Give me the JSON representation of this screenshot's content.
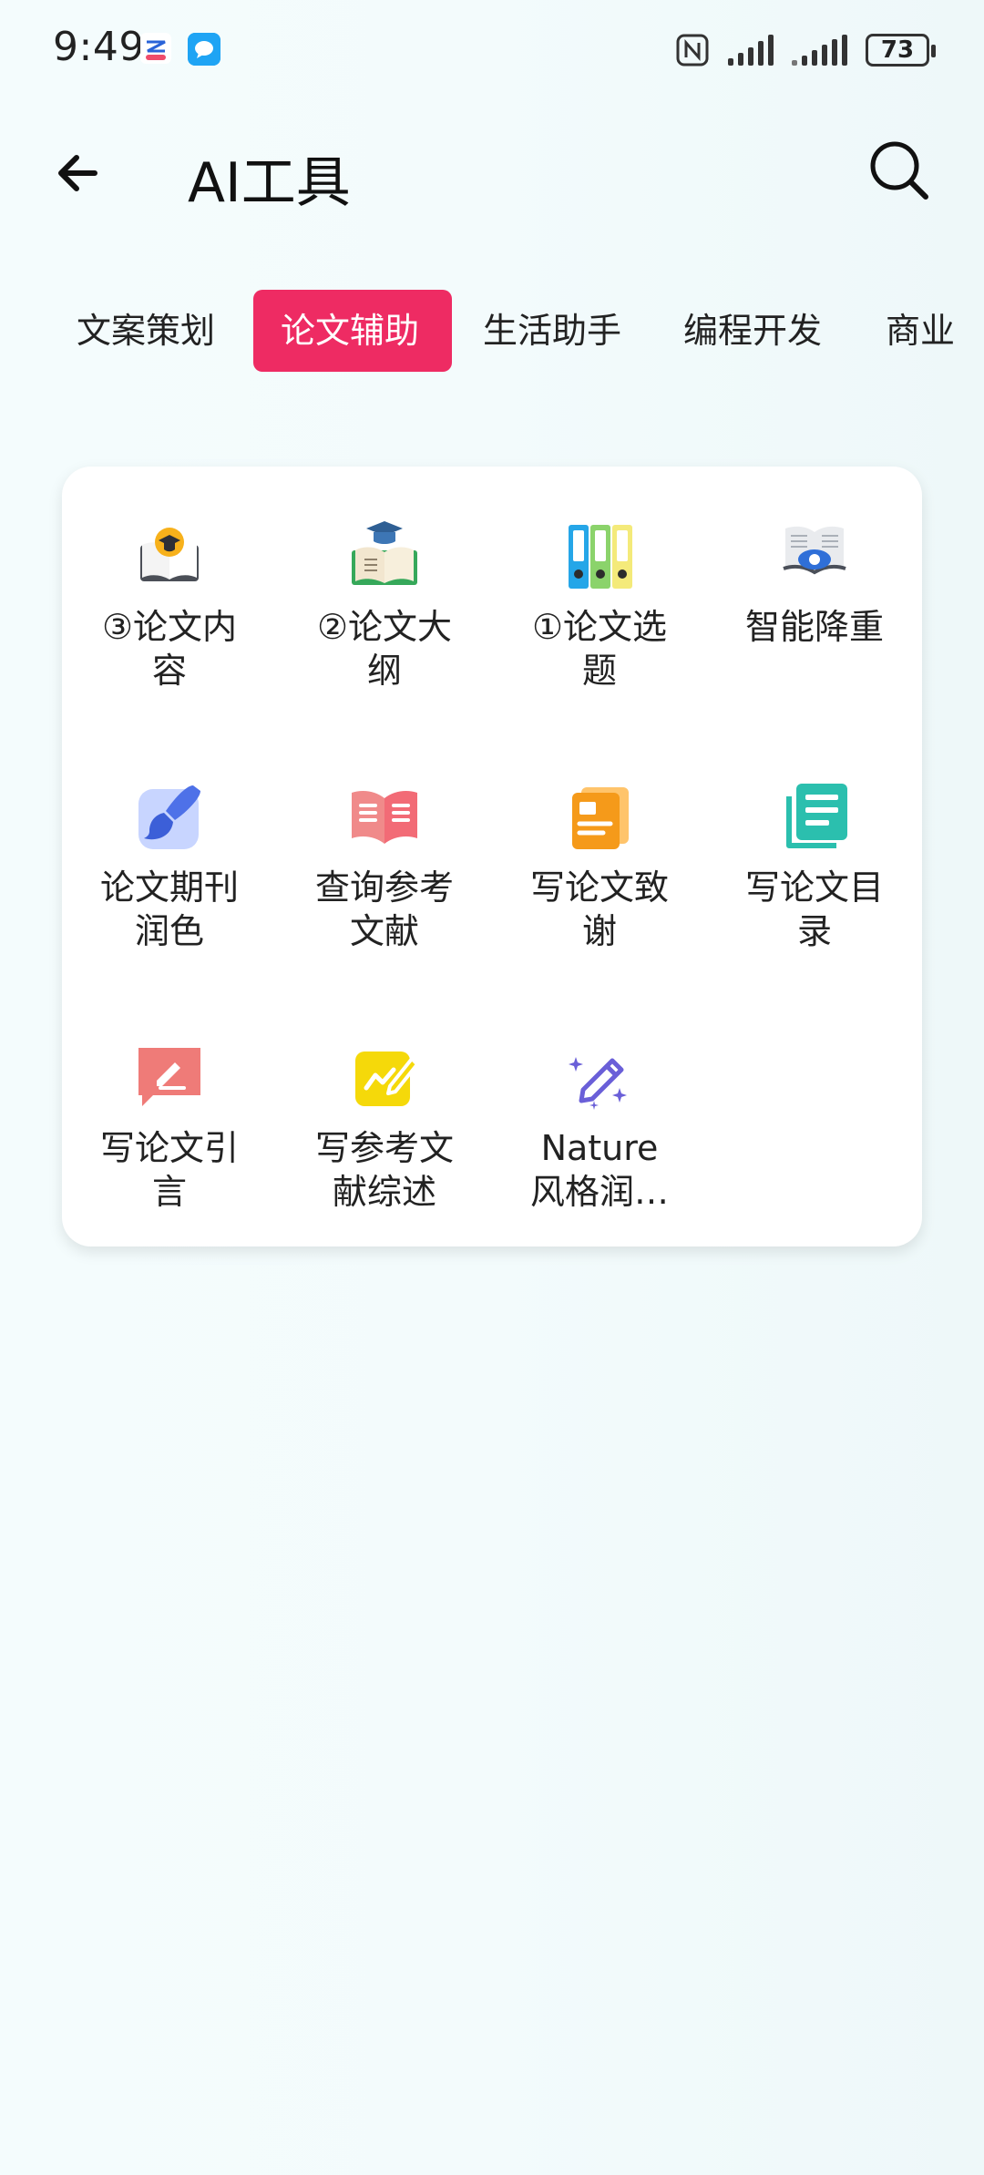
{
  "status": {
    "time": "9:49",
    "battery": "73"
  },
  "header": {
    "title": "AI工具"
  },
  "tabs": [
    {
      "label": "文案策划"
    },
    {
      "label": "论文辅助"
    },
    {
      "label": "生活助手"
    },
    {
      "label": "编程开发"
    },
    {
      "label": "商业"
    }
  ],
  "tools": [
    {
      "label_line1": "③论文内",
      "label_line2": "容",
      "icon": "book-graduate-icon"
    },
    {
      "label_line1": "②论文大",
      "label_line2": "纲",
      "icon": "graduate-book-icon"
    },
    {
      "label_line1": "①论文选",
      "label_line2": "题",
      "icon": "binders-icon"
    },
    {
      "label_line1": "智能降重",
      "label_line2": "",
      "icon": "eye-book-icon"
    },
    {
      "label_line1": "论文期刊",
      "label_line2": "润色",
      "icon": "paintbrush-icon"
    },
    {
      "label_line1": "查询参考",
      "label_line2": "文献",
      "icon": "open-book-icon"
    },
    {
      "label_line1": "写论文致",
      "label_line2": "谢",
      "icon": "document-card-icon"
    },
    {
      "label_line1": "写论文目",
      "label_line2": "录",
      "icon": "stacked-document-icon"
    },
    {
      "label_line1": "写论文引",
      "label_line2": "言",
      "icon": "pen-bubble-icon"
    },
    {
      "label_line1": "写参考文",
      "label_line2": "献综述",
      "icon": "edit-note-icon"
    },
    {
      "label_line1": "Nature",
      "label_line2": "风格润…",
      "icon": "sparkle-pencil-icon"
    }
  ]
}
